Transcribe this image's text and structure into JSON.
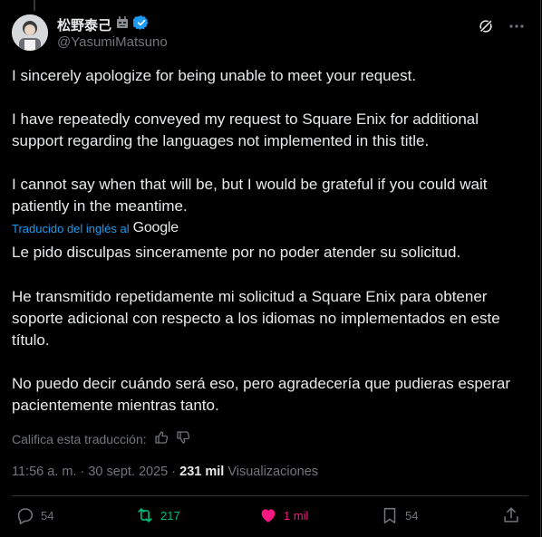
{
  "author": {
    "display_name": "松野泰己",
    "handle": "@YasumiMatsuno"
  },
  "post": {
    "original": [
      "I sincerely apologize for being unable to meet your request.",
      "I have repeatedly conveyed my request to Square Enix for additional support regarding the languages not implemented in this title.",
      "I cannot say when that will be, but I would be grateful if you could wait patiently in the meantime."
    ],
    "translation_label": "Traducido del inglés al",
    "translation_provider": "Google",
    "translated": [
      "Le pido disculpas sinceramente por no poder atender su solicitud.",
      "He transmitido repetidamente mi solicitud a Square Enix para obtener soporte adicional con respecto a los idiomas no implementados en este título.",
      "No puedo decir cuándo será eso, pero agradecería que pudieras esperar pacientemente mientras tanto."
    ],
    "rate_translation_label": "Califica esta traducción:"
  },
  "meta": {
    "time": "11:56 a. m.",
    "separator": " · ",
    "date": "30 sept. 2025",
    "views_count": "231 mil",
    "views_label": " Visualizaciones"
  },
  "actions": {
    "replies": "54",
    "reposts": "217",
    "likes": "1 mil",
    "bookmarks": "54"
  },
  "colors": {
    "background": "#000000",
    "text": "#e7e9ea",
    "muted": "#71767b",
    "link": "#1d9bf0",
    "repost": "#00ba7c",
    "like": "#f91880",
    "verified": "#1d9bf0"
  },
  "icons": [
    "avatar",
    "robot-emoji-icon",
    "verified-badge-icon",
    "grok-icon",
    "more-options-icon",
    "thumbs-up-icon",
    "thumbs-down-icon",
    "reply-icon",
    "repost-icon",
    "like-heart-icon",
    "bookmark-icon",
    "share-icon"
  ]
}
